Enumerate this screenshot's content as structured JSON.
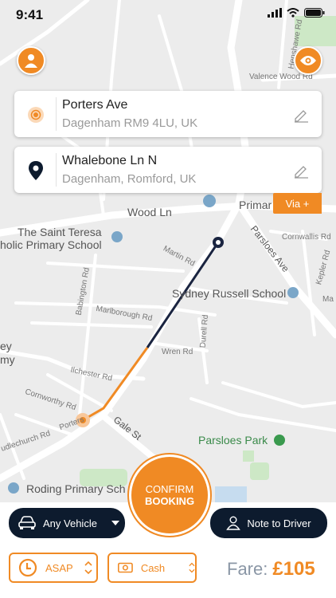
{
  "status_bar": {
    "time": "9:41"
  },
  "pickup": {
    "name": "Porters Ave",
    "detail": "Dagenham RM9 4LU, UK"
  },
  "dropoff": {
    "name": "Whalebone Ln N",
    "detail": "Dagenham, Romford, UK"
  },
  "via_label": "Via +",
  "map_labels": {
    "wood_ln": "Wood Ln",
    "primary": "Primar",
    "saint_teresa_1": "The Saint Teresa",
    "saint_teresa_2": "holic Primary School",
    "sydney": "Sydney Russell School",
    "parsloes_park": "Parsloes Park",
    "roding": "Roding Primary Sch",
    "martin_rd": "Martin Rd",
    "marlborough_rd": "Marlborough Rd",
    "wren_rd": "Wren Rd",
    "ilchester_rd": "Ilchester Rd",
    "cornworthy_rd": "Cornworthy Rd",
    "gale_st": "Gale St",
    "babington_rd": "Babington Rd",
    "durell_rd": "Durell Rd",
    "parsloes_ave": "Parsloes Ave",
    "cornwallis_rd": "Cornwallis Rd",
    "kepler_rd": "Kepler Rd",
    "valence_wood_rd": "Valence Wood Rd",
    "henshawe_rd": "Henshawe Rd",
    "porters": "Porters",
    "udlechurch_rd": "udlechurch Rd",
    "ey": "ey",
    "my": "my",
    "ma": "Ma"
  },
  "confirm": {
    "line1": "CONFIRM",
    "line2": "BOOKING"
  },
  "vehicle": {
    "label": "Any Vehicle"
  },
  "note": {
    "label": "Note to Driver"
  },
  "time_option": {
    "label": "ASAP"
  },
  "payment": {
    "label": "Cash"
  },
  "fare": {
    "label": "Fare:",
    "amount": "£105"
  },
  "colors": {
    "accent": "#f08a24",
    "navy": "#0d1b2e",
    "route": "#1a2440"
  },
  "icons": [
    "profile-icon",
    "eye-icon",
    "pickup-dot-icon",
    "location-pin-icon",
    "pencil-icon",
    "car-icon",
    "dropdown-arrow-icon",
    "user-outline-icon",
    "clock-icon",
    "cash-icon",
    "up-down-chevron-icon"
  ]
}
